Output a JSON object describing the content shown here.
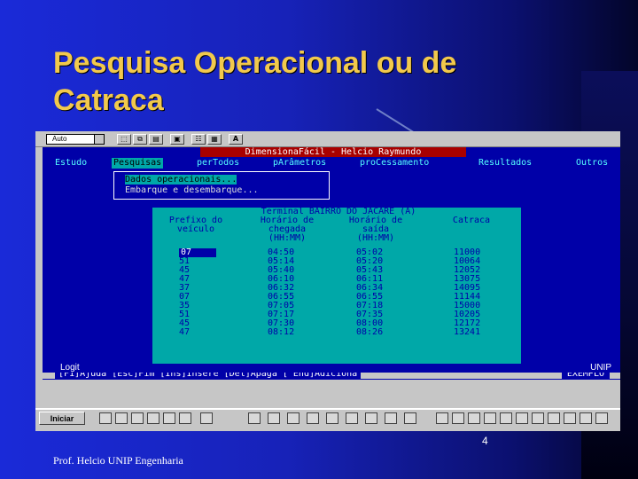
{
  "slide": {
    "title_line1": "Pesquisa Operacional ou de",
    "title_line2": "Catraca",
    "page_number": "4",
    "footer": "Prof. Helcio UNIP Engenharia"
  },
  "toolbar": {
    "font_select": "Auto",
    "button_a": "A"
  },
  "app": {
    "title": "DimensionaFácil - Helcio Raymundo",
    "menu": [
      "Estudo",
      "Pesquisas",
      "perTodos",
      "pArâmetros",
      "proCessamento",
      "Resultados",
      "Outros"
    ],
    "dropdown": [
      "Dados operacionais...",
      "Embarque e desembarque..."
    ],
    "panel": {
      "title": "Terminal BAIRRO DO JACARE (A)",
      "headers": [
        [
          "Prefixo do",
          "veículo"
        ],
        [
          "Horário de",
          "chegada",
          "(HH:MM)"
        ],
        [
          "Horário de",
          "saída",
          "(HH:MM)"
        ],
        [
          "Catraca"
        ]
      ],
      "prefixes": [
        "07",
        "51",
        "45",
        "47",
        "37",
        "07",
        "35",
        "51",
        "45",
        "47"
      ],
      "arrivals": [
        "04:50",
        "05:14",
        "05:40",
        "06:10",
        "06:32",
        "06:55",
        "07:05",
        "07:17",
        "07:30",
        "08:12"
      ],
      "departures": [
        "05:02",
        "05:20",
        "05:43",
        "06:11",
        "06:34",
        "06:55",
        "07:18",
        "07:35",
        "08:00",
        "08:26"
      ],
      "catraca": [
        "11000",
        "10064",
        "12052",
        "13075",
        "14095",
        "11144",
        "15000",
        "10205",
        "12172",
        "13241"
      ]
    },
    "status_left": "[F1]Ajuda [Esc]Fim [Ins]Insere [Del]Apaga [^End]Adiciona",
    "status_right": "EXEMPLO",
    "log_left": "Logit",
    "log_right": "UNIP"
  },
  "taskbar": {
    "start_label": "Iniciar"
  }
}
